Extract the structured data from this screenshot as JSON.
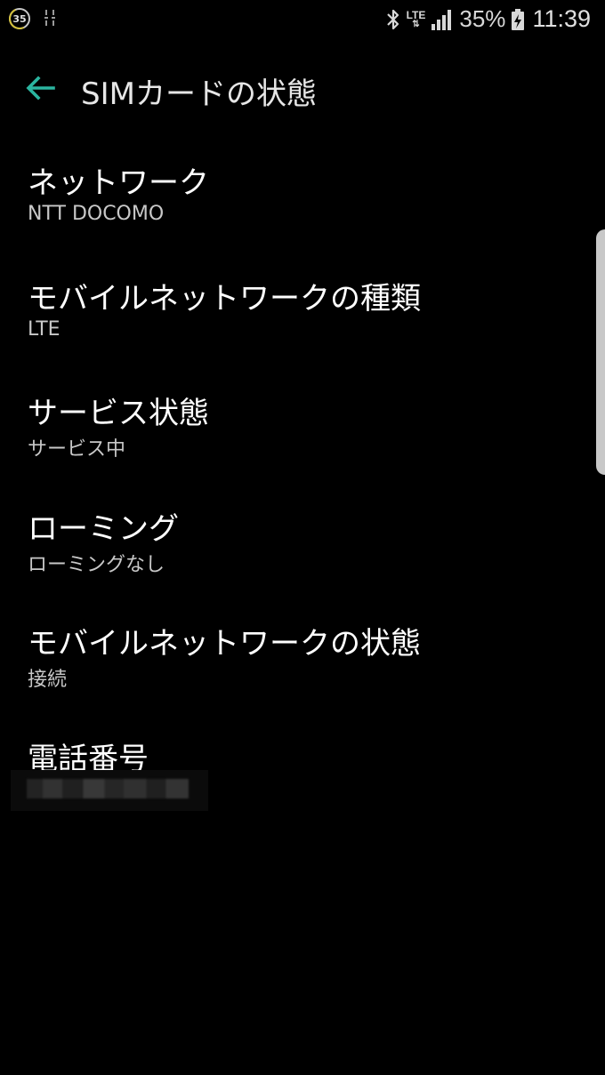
{
  "status_bar": {
    "badge": "35",
    "network_type": "LTE",
    "battery": "35%",
    "time": "11:39",
    "icons": [
      "circle-35-icon",
      "data-sync-icon",
      "bluetooth-icon",
      "lte-icon",
      "signal-icon",
      "battery-charging-icon"
    ]
  },
  "header": {
    "title": "SIMカードの状態",
    "back_icon": "arrow-left-icon"
  },
  "items": [
    {
      "title": "ネットワーク",
      "value": "NTT DOCOMO"
    },
    {
      "title": "モバイルネットワークの種類",
      "value": "LTE"
    },
    {
      "title": "サービス状態",
      "value": "サービス中"
    },
    {
      "title": "ローミング",
      "value": "ローミングなし"
    },
    {
      "title": "モバイルネットワークの状態",
      "value": "接続"
    },
    {
      "title": "電話番号",
      "value": ""
    }
  ],
  "colors": {
    "background": "#000000",
    "accent": "#2bb5a0",
    "title": "#ffffff",
    "value": "#c8c8c8"
  }
}
